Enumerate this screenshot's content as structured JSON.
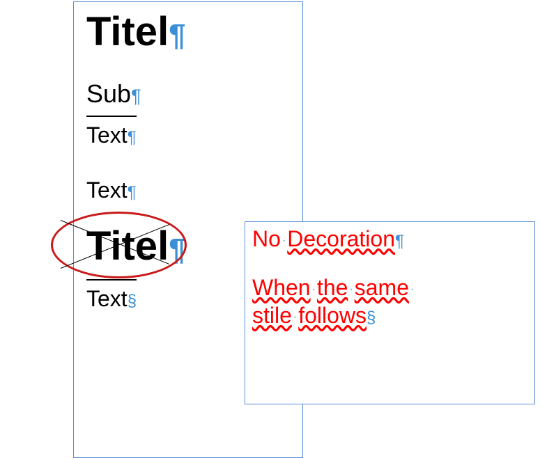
{
  "frame1": {
    "title1": "Titel",
    "sub": "Sub",
    "text1": "Text",
    "text2": "Text",
    "title2": "Titel",
    "text3": "Text"
  },
  "frame2": {
    "line1_word1": "No",
    "line1_word2": "Decoration",
    "line2_word1": "When",
    "line2_word2": "the",
    "line2_word3": "same",
    "line3_word1": "stile",
    "line3_word2": "follows"
  },
  "marks": {
    "pilcrow": "¶",
    "section": "§",
    "dot": "·"
  }
}
